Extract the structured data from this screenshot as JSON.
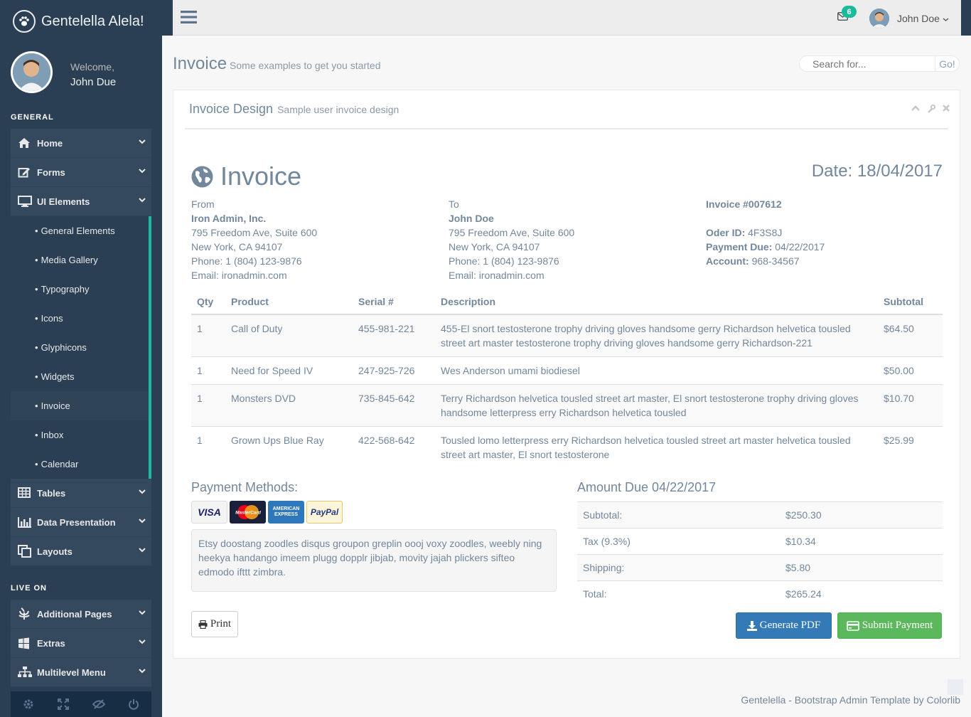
{
  "sidebar": {
    "brand": "Gentelella Alela!",
    "welcome": "Welcome,",
    "user_name": "John Due",
    "section_general": "GENERAL",
    "section_live": "LIVE ON",
    "menu_general": [
      {
        "label": "Home",
        "icon": "home-icon"
      },
      {
        "label": "Forms",
        "icon": "edit-icon"
      },
      {
        "label": "UI Elements",
        "icon": "desktop-icon"
      }
    ],
    "submenu": [
      {
        "label": "General Elements"
      },
      {
        "label": "Media Gallery"
      },
      {
        "label": "Typography"
      },
      {
        "label": "Icons"
      },
      {
        "label": "Glyphicons"
      },
      {
        "label": "Widgets"
      },
      {
        "label": "Invoice"
      },
      {
        "label": "Inbox"
      },
      {
        "label": "Calendar"
      }
    ],
    "menu_general2": [
      {
        "label": "Tables",
        "icon": "table-icon"
      },
      {
        "label": "Data Presentation",
        "icon": "bar-chart-icon"
      },
      {
        "label": "Layouts",
        "icon": "clone-icon"
      }
    ],
    "menu_live": [
      {
        "label": "Additional Pages",
        "icon": "bug-icon"
      },
      {
        "label": "Extras",
        "icon": "windows-icon"
      },
      {
        "label": "Multilevel Menu",
        "icon": "sitemap-icon"
      }
    ],
    "active_item": "Invoice"
  },
  "topnav": {
    "mail_count": "6",
    "user_name": "John Doe"
  },
  "page": {
    "title": "Invoice",
    "subtitle": "Some examples to get you started",
    "search_placeholder": "Search for...",
    "search_button": "Go!"
  },
  "panel": {
    "title": "Invoice Design",
    "subtitle": "Sample user invoice design"
  },
  "invoice": {
    "heading": "Invoice",
    "date": "Date: 18/04/2017",
    "from": {
      "label": "From",
      "name": "Iron Admin, Inc.",
      "address1": "795 Freedom Ave, Suite 600",
      "address2": "New York, CA 94107",
      "phone": "Phone: 1 (804) 123-9876",
      "email": "Email: ironadmin.com"
    },
    "to": {
      "label": "To",
      "name": "John Doe",
      "address1": "795 Freedom Ave, Suite 600",
      "address2": "New York, CA 94107",
      "phone": "Phone: 1 (804) 123-9876",
      "email": "Email: ironadmin.com"
    },
    "meta": {
      "number": "Invoice #007612",
      "order_label": "Oder ID:",
      "order_value": "4F3S8J",
      "due_label": "Payment Due:",
      "due_value": "04/22/2017",
      "account_label": "Account:",
      "account_value": "968-34567"
    },
    "columns": [
      "Qty",
      "Product",
      "Serial #",
      "Description",
      "Subtotal"
    ],
    "rows": [
      {
        "qty": "1",
        "product": "Call of Duty",
        "serial": "455-981-221",
        "description": "455-El snort testosterone trophy driving gloves handsome gerry Richardson helvetica tousled street art master testosterone trophy driving gloves handsome gerry Richardson-221",
        "subtotal": "$64.50"
      },
      {
        "qty": "1",
        "product": "Need for Speed IV",
        "serial": "247-925-726",
        "description": "Wes Anderson umami biodiesel",
        "subtotal": "$50.00"
      },
      {
        "qty": "1",
        "product": "Monsters DVD",
        "serial": "735-845-642",
        "description": "Terry Richardson helvetica tousled street art master, El snort testosterone trophy driving gloves handsome letterpress erry Richardson helvetica tousled",
        "subtotal": "$10.70"
      },
      {
        "qty": "1",
        "product": "Grown Ups Blue Ray",
        "serial": "422-568-642",
        "description": "Tousled lomo letterpress erry Richardson helvetica tousled street art master helvetica tousled street art master, El snort testosterone",
        "subtotal": "$25.99"
      }
    ],
    "payment_title": "Payment Methods:",
    "cards": [
      "VISA",
      "MasterCard",
      "AMERICAN EXPRESS",
      "PayPal"
    ],
    "payment_note": "Etsy doostang zoodles disqus groupon greplin oooj voxy zoodles, weebly ning heekya handango imeem plugg dopplr jibjab, movity jajah plickers sifteo edmodo ifttt zimbra.",
    "amount_title": "Amount Due 04/22/2017",
    "totals": [
      {
        "label": "Subtotal:",
        "value": "$250.30"
      },
      {
        "label": "Tax (9.3%)",
        "value": "$10.34"
      },
      {
        "label": "Shipping:",
        "value": "$5.80"
      },
      {
        "label": "Total:",
        "value": "$265.24"
      }
    ],
    "print_label": "Print",
    "pdf_label": "Generate PDF",
    "pay_label": "Submit Payment"
  },
  "footer": "Gentelella - Bootstrap Admin Template by Colorlib",
  "colors": {
    "sidebar": "#2A3F54",
    "accent": "#1ABB9C",
    "primary": "#337ab7",
    "success": "#5cb85c"
  }
}
